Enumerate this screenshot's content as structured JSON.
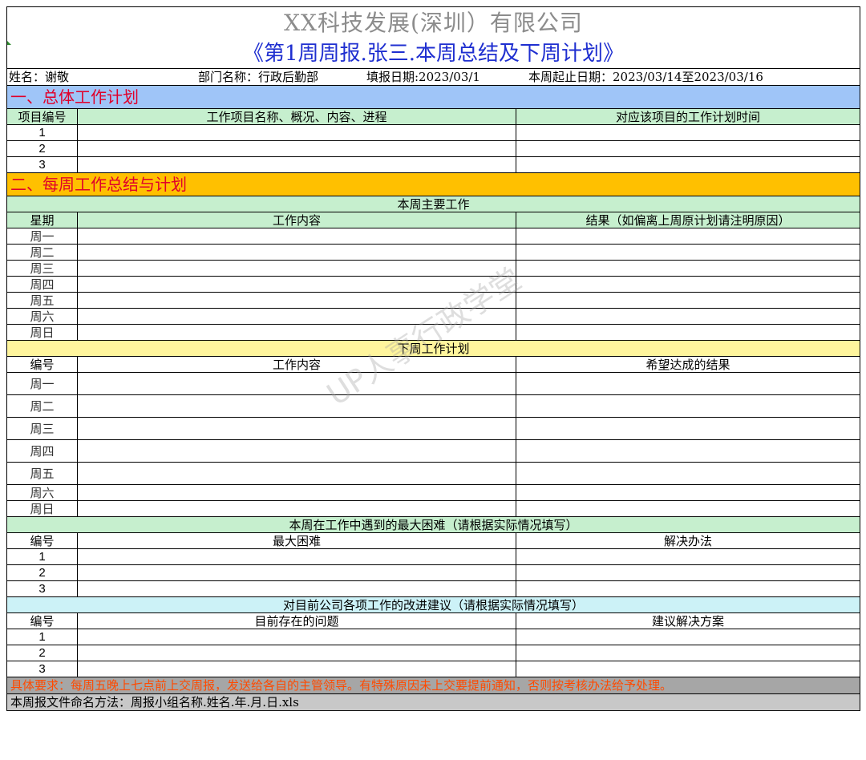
{
  "header": {
    "company": "XX科技发展(深圳）有限公司",
    "report_title": "《第1周周报.张三.本周总结及下周计划》"
  },
  "info": {
    "name": "姓名：谢敬",
    "department": "部门名称：行政后勤部",
    "fill_date": "填报日期:2023/03/1",
    "period": "本周起止日期：2023/03/14至2023/03/16"
  },
  "section1": {
    "title": "一、总体工作计划",
    "columns": [
      "项目编号",
      "工作项目名称、概况、内容、进程",
      "对应该项目的工作计划时间"
    ],
    "rows": [
      "1",
      "2",
      "3"
    ]
  },
  "section2": {
    "title": "二、每周工作总结与计划",
    "this_week": {
      "heading": "本周主要工作",
      "columns": [
        "星期",
        "工作内容",
        "结果（如偏离上周原计划请注明原因）"
      ],
      "days": [
        "周一",
        "周二",
        "周三",
        "周四",
        "周五",
        "周六",
        "周日"
      ]
    },
    "next_week": {
      "heading": "下周工作计划",
      "columns": [
        "编号",
        "工作内容",
        "希望达成的结果"
      ],
      "days": [
        "周一",
        "周二",
        "周三",
        "周四",
        "周五",
        "周六",
        "周日"
      ]
    },
    "difficulties": {
      "heading": "本周在工作中遇到的最大困难（请根据实际情况填写）",
      "columns": [
        "编号",
        "最大困难",
        "解决办法"
      ],
      "rows": [
        "1",
        "2",
        "3"
      ]
    },
    "suggestions": {
      "heading": "对目前公司各项工作的改进建议（请根据实际情况填写）",
      "columns": [
        "编号",
        "目前存在的问题",
        "建议解决方案"
      ],
      "rows": [
        "1",
        "2",
        "3"
      ]
    }
  },
  "footer": {
    "requirement": "具体要求：每周五晚上七点前上交周报，发送给各自的主管领导。有特殊原因未上交要提前通知，否则按考核办法给予处理。",
    "naming": "本周报文件命名方法：周报小组名称.姓名.年.月.日.xls"
  },
  "watermark": "UP人事行政学堂"
}
